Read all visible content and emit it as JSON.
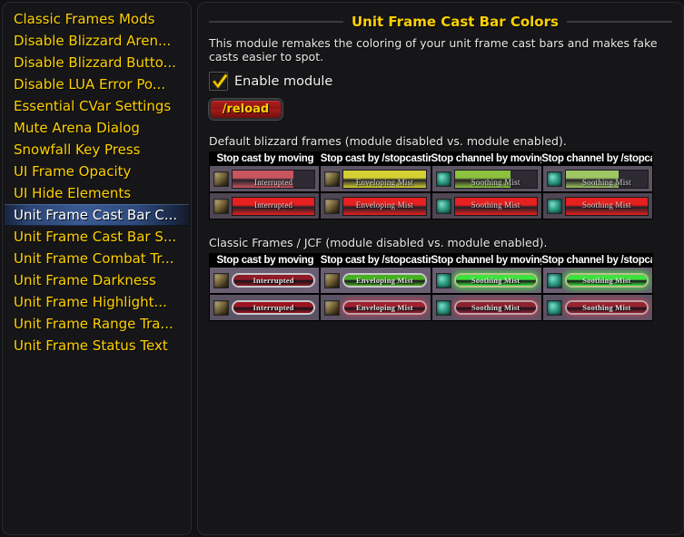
{
  "sidebar": {
    "items": [
      {
        "label": "Classic Frames Mods",
        "selected": false
      },
      {
        "label": "Disable Blizzard Aren...",
        "selected": false
      },
      {
        "label": "Disable Blizzard Butto...",
        "selected": false
      },
      {
        "label": "Disable LUA Error Po...",
        "selected": false
      },
      {
        "label": "Essential CVar Settings",
        "selected": false
      },
      {
        "label": "Mute Arena Dialog",
        "selected": false
      },
      {
        "label": "Snowfall Key Press",
        "selected": false
      },
      {
        "label": "UI Frame Opacity",
        "selected": false
      },
      {
        "label": "UI Hide Elements",
        "selected": false
      },
      {
        "label": "Unit Frame Cast Bar C...",
        "selected": true
      },
      {
        "label": "Unit Frame Cast Bar S...",
        "selected": false
      },
      {
        "label": "Unit Frame Combat Tr...",
        "selected": false
      },
      {
        "label": "Unit Frame Darkness",
        "selected": false
      },
      {
        "label": "Unit Frame Highlight...",
        "selected": false
      },
      {
        "label": "Unit Frame Range Tra...",
        "selected": false
      },
      {
        "label": "Unit Frame Status Text",
        "selected": false
      }
    ]
  },
  "main": {
    "title": "Unit Frame Cast Bar Colors",
    "description": "This module remakes the coloring of your unit frame cast bars and makes fake casts easier to spot.",
    "enable_checkbox": {
      "label": "Enable module",
      "checked": true
    },
    "reload_button": {
      "label": "/reload"
    },
    "sections": [
      {
        "caption": "Default blizzard frames (module disabled vs. module enabled).",
        "columns": [
          "Stop cast by moving",
          "Stop cast by /stopcasting",
          "Stop channel by moving",
          "Stop channel by /stopcasting"
        ],
        "rows": [
          {
            "state": "disabled",
            "cells": [
              {
                "spell": "Interrupted",
                "icon": "envelop-icon",
                "fill_percent": 74,
                "fill_color": "#c8565f"
              },
              {
                "spell": "Enveloping Mist",
                "icon": "envelop-icon",
                "fill_percent": 100,
                "fill_color": "#d4d033"
              },
              {
                "spell": "Soothing Mist",
                "icon": "sooth-icon",
                "fill_percent": 68,
                "fill_color": "#8cc23d"
              },
              {
                "spell": "Soothing Mist",
                "icon": "sooth-icon",
                "fill_percent": 64,
                "fill_color": "#9ec663"
              }
            ]
          },
          {
            "state": "enabled",
            "cells": [
              {
                "spell": "Interrupted",
                "icon": "envelop-icon",
                "fill_percent": 100,
                "fill_color": "#e61f1f"
              },
              {
                "spell": "Enveloping Mist",
                "icon": "envelop-icon",
                "fill_percent": 100,
                "fill_color": "#e61f1f"
              },
              {
                "spell": "Soothing Mist",
                "icon": "sooth-icon",
                "fill_percent": 100,
                "fill_color": "#e61f1f"
              },
              {
                "spell": "Soothing Mist",
                "icon": "sooth-icon",
                "fill_percent": 100,
                "fill_color": "#e61f1f"
              }
            ]
          }
        ]
      },
      {
        "caption": "Classic Frames / JCF (module disabled vs. module enabled).",
        "columns": [
          "Stop cast by moving",
          "Stop cast by /stopcasting",
          "Stop channel by moving",
          "Stop channel by /stopcasting"
        ],
        "rows": [
          {
            "state": "disabled",
            "cells": [
              {
                "spell": "Interrupted",
                "icon": "envelop-icon",
                "fill_percent": 100,
                "fill_color": "#8e1b26",
                "glow": "none"
              },
              {
                "spell": "Enveloping Mist",
                "icon": "envelop-icon",
                "fill_percent": 100,
                "fill_color": "#45b020",
                "glow": "none"
              },
              {
                "spell": "Soothing Mist",
                "icon": "sooth-icon",
                "fill_percent": 100,
                "fill_color": "#3ee23e",
                "glow": "green"
              },
              {
                "spell": "Soothing Mist",
                "icon": "sooth-icon",
                "fill_percent": 100,
                "fill_color": "#3ee23e",
                "glow": "green"
              }
            ]
          },
          {
            "state": "enabled",
            "cells": [
              {
                "spell": "Interrupted",
                "icon": "envelop-icon",
                "fill_percent": 100,
                "fill_color": "#9c1420",
                "glow": "none"
              },
              {
                "spell": "Enveloping Mist",
                "icon": "envelop-icon",
                "fill_percent": 100,
                "fill_color": "#a0202f",
                "glow": "red"
              },
              {
                "spell": "Soothing Mist",
                "icon": "sooth-icon",
                "fill_percent": 100,
                "fill_color": "#8f2230",
                "glow": "red"
              },
              {
                "spell": "Soothing Mist",
                "icon": "sooth-icon",
                "fill_percent": 100,
                "fill_color": "#982330",
                "glow": "red"
              }
            ]
          }
        ]
      }
    ]
  },
  "colors": {
    "accent_yellow": "#ffd100",
    "selection_blue": "#3a5a93",
    "panel_bg": "#161618",
    "reload_red": "#a81b1b"
  }
}
